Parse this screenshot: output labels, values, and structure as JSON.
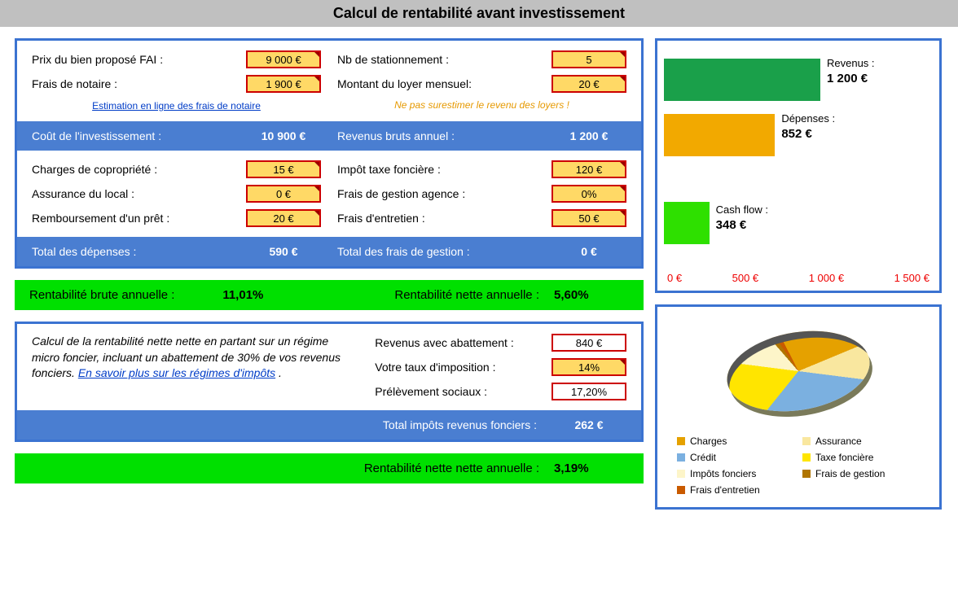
{
  "title": "Calcul de rentabilité avant investissement",
  "inputs": {
    "prix_fai": {
      "label": "Prix du bien proposé FAI :",
      "value": "9 000 €"
    },
    "frais_notaire": {
      "label": "Frais de notaire :",
      "value": "1 900 €"
    },
    "estimation_link": "Estimation en ligne des frais de notaire",
    "nb_stationnement": {
      "label": "Nb de stationnement :",
      "value": "5"
    },
    "loyer_mensuel": {
      "label": "Montant du loyer mensuel:",
      "value": "20 €"
    },
    "loyer_note": "Ne pas surestimer le revenu des loyers !"
  },
  "summary1": {
    "cout_label": "Coût de l'investissement :",
    "cout_value": "10 900 €",
    "rev_label": "Revenus bruts annuel :",
    "rev_value": "1 200 €"
  },
  "charges": {
    "copro": {
      "label": "Charges de copropriété :",
      "value": "15 €"
    },
    "assurance": {
      "label": "Assurance du local :",
      "value": "0 €"
    },
    "pret": {
      "label": "Remboursement d'un prêt :",
      "value": "20 €"
    },
    "taxe": {
      "label": "Impôt taxe foncière :",
      "value": "120 €"
    },
    "agence": {
      "label": "Frais de gestion agence :",
      "value": "0%"
    },
    "entretien": {
      "label": "Frais d'entretien :",
      "value": "50 €"
    }
  },
  "summary2": {
    "dep_label": "Total des dépenses :",
    "dep_value": "590 €",
    "gest_label": "Total des frais de gestion :",
    "gest_value": "0 €"
  },
  "rentab": {
    "brute_label": "Rentabilité brute annuelle :",
    "brute_value": "11,01%",
    "nette_label": "Rentabilité nette annuelle :",
    "nette_value": "5,60%"
  },
  "tax_panel": {
    "desc_prefix": "Calcul de la rentabilité nette nette en partant sur un régime micro foncier, incluant un abattement de 30% de vos revenus fonciers.  ",
    "desc_link": "En savoir plus sur les régimes d'impôts",
    "desc_suffix": " .",
    "abattement": {
      "label": "Revenus avec abattement :",
      "value": "840 €"
    },
    "taux": {
      "label": "Votre taux d'imposition :",
      "value": "14%"
    },
    "sociaux": {
      "label": "Prélèvement sociaux :",
      "value": "17,20%"
    }
  },
  "summary3": {
    "imp_label": "Total impôts revenus fonciers :",
    "imp_value": "262 €"
  },
  "final": {
    "label": "Rentabilité nette nette annuelle :",
    "value": "3,19%"
  },
  "chart_data": {
    "type": "bar",
    "orientation": "horizontal",
    "categories": [
      "Revenus",
      "Dépenses",
      "Cash flow"
    ],
    "values": [
      1200,
      852,
      348
    ],
    "colors": [
      "#1aa04a",
      "#f2a900",
      "#2ee000"
    ],
    "display_values": [
      "1 200 €",
      "852 €",
      "348 €"
    ],
    "display_labels": [
      "Revenus :",
      "Dépenses :",
      "Cash flow :"
    ],
    "xticks": [
      "0 €",
      "500 €",
      "1 000 €",
      "1 500 €"
    ],
    "xlim": [
      0,
      1500
    ]
  },
  "pie_data": {
    "type": "pie",
    "legend": [
      {
        "name": "Charges",
        "color": "#e5a100"
      },
      {
        "name": "Assurance",
        "color": "#f9e79f"
      },
      {
        "name": "Crédit",
        "color": "#7bb0e0"
      },
      {
        "name": "Taxe foncière",
        "color": "#ffe500"
      },
      {
        "name": "Impôts fonciers",
        "color": "#fdf5c9"
      },
      {
        "name": "Frais de gestion",
        "color": "#b07500"
      },
      {
        "name": "Frais d'entretien",
        "color": "#c95a00"
      }
    ]
  }
}
